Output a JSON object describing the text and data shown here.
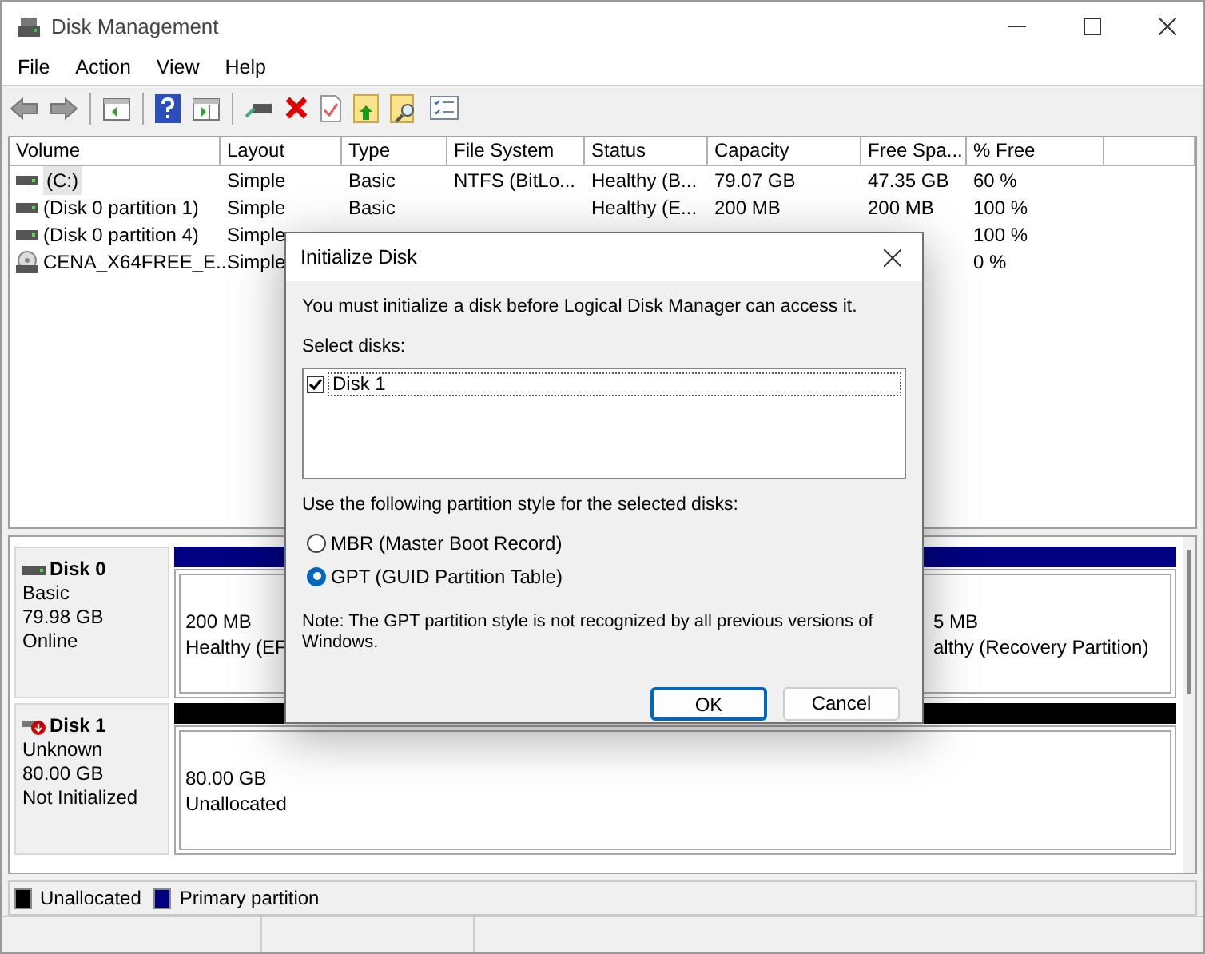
{
  "window": {
    "title": "Disk Management"
  },
  "menu": [
    "File",
    "Action",
    "View",
    "Help"
  ],
  "table": {
    "columns": [
      "Volume",
      "Layout",
      "Type",
      "File System",
      "Status",
      "Capacity",
      "Free Spa...",
      "% Free"
    ],
    "rows": [
      {
        "kind": "drive",
        "selected": true,
        "volume": "(C:)",
        "layout": "Simple",
        "type": "Basic",
        "file_system": "NTFS (BitLo...",
        "status": "Healthy (B...",
        "capacity": "79.07 GB",
        "free_space": "47.35 GB",
        "percent_free": "60 %"
      },
      {
        "kind": "drive",
        "selected": false,
        "volume": "(Disk 0 partition 1)",
        "layout": "Simple",
        "type": "Basic",
        "status": "Healthy (E...",
        "capacity": "200 MB",
        "free_space": "200 MB",
        "percent_free": "100 %"
      },
      {
        "kind": "drive",
        "selected": false,
        "volume": "(Disk 0 partition 4)",
        "layout": "Simple",
        "percent_free": "100 %"
      },
      {
        "kind": "disc",
        "selected": false,
        "volume": "CENA_X64FREE_E...",
        "layout": "Simple",
        "percent_free": "0 %"
      }
    ]
  },
  "disks": [
    {
      "kind": "online",
      "name": "Disk 0",
      "type": "Basic",
      "size": "79.98 GB",
      "state": "Online",
      "partitions": [
        {
          "kind": "primary",
          "size": "200 MB",
          "status": "Healthy (EF"
        },
        {
          "kind": "primary",
          "size": "5 MB",
          "status": "althy (Recovery Partition)"
        }
      ]
    },
    {
      "kind": "not_initialized",
      "name": "Disk 1",
      "type": "Unknown",
      "size": "80.00 GB",
      "state": "Not Initialized",
      "partitions": [
        {
          "kind": "unallocated",
          "size": "80.00 GB",
          "status": "Unallocated"
        }
      ]
    }
  ],
  "legend": [
    {
      "label": "Unallocated",
      "color": "#000000"
    },
    {
      "label": "Primary partition",
      "color": "#000080"
    }
  ],
  "dialog": {
    "title": "Initialize Disk",
    "message": "You must initialize a disk before Logical Disk Manager can access it.",
    "select_label": "Select disks:",
    "disks": [
      {
        "label": "Disk 1",
        "checked": true,
        "selected": true
      }
    ],
    "style_label": "Use the following partition style for the selected disks:",
    "styles": [
      {
        "label": "MBR (Master Boot Record)",
        "selected": false
      },
      {
        "label": "GPT (GUID Partition Table)",
        "selected": true
      }
    ],
    "note": "Note: The GPT partition style is not recognized by all previous versions of Windows.",
    "buttons": [
      {
        "label": "OK",
        "default": true
      },
      {
        "label": "Cancel",
        "default": false
      }
    ]
  }
}
